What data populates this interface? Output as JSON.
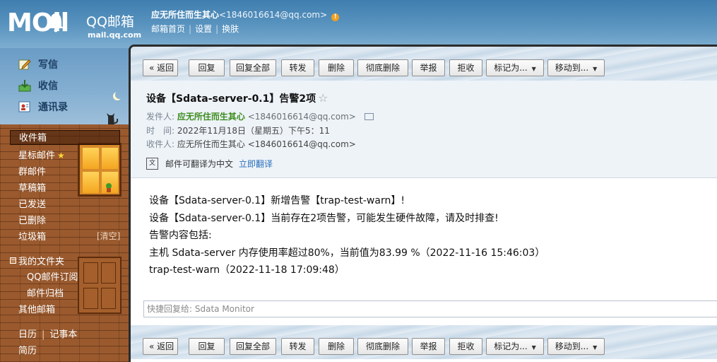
{
  "brand": {
    "logo_text": "MOil",
    "product_name": "QQ邮箱",
    "domain": "mail.qq.com"
  },
  "user": {
    "display_name": "应无所住而生其心",
    "email": "<1846016614@qq.com>",
    "warning_icon": "exclamation-icon"
  },
  "top_links": [
    "邮箱首页",
    "设置",
    "换肤"
  ],
  "quick_actions": [
    {
      "label": "写信",
      "icon": "pencil-icon"
    },
    {
      "label": "收信",
      "icon": "download-icon"
    },
    {
      "label": "通讯录",
      "icon": "contacts-icon"
    }
  ],
  "folders": {
    "inbox": "收件箱",
    "starred": "星标邮件",
    "group": "群邮件",
    "drafts": "草稿箱",
    "sent": "已发送",
    "deleted": "已删除",
    "spam": "垃圾箱",
    "clear_label": "[清空]",
    "my_folders": "我的文件夹",
    "my_folders_toggle": "−",
    "sub_folders": [
      "QQ邮件订阅",
      "邮件归档"
    ],
    "other_mailboxes": "其他邮箱",
    "calendar": "日历",
    "notes": "记事本",
    "resume": "简历"
  },
  "toolbar": {
    "back": "« 返回",
    "reply": "回复",
    "reply_all": "回复全部",
    "forward": "转发",
    "delete": "删除",
    "delete_permanently": "彻底删除",
    "report": "举报",
    "reject": "拒收",
    "mark_as": "标记为...",
    "move_to": "移动到..."
  },
  "mail": {
    "subject": "设备【Sdata-server-0.1】告警2项",
    "star": "☆",
    "from_label": "发件人:",
    "from_name": "应无所住而生其心",
    "from_addr": "<1846016614@qq.com>",
    "time_label": "时　间:",
    "time_value": "2022年11月18日（星期五）下午5：11",
    "to_label": "收件人:",
    "to_value": "应无所住而生其心 <1846016614@qq.com>",
    "translate_text": "邮件可翻译为中文",
    "translate_link": "立即翻译",
    "body": [
      "设备【Sdata-server-0.1】新增告警【trap-test-warn】!",
      "设备【Sdata-server-0.1】当前存在2项告警，可能发生硬件故障，请及时排查!",
      "告警内容包括:",
      "主机 Sdata-server 内存使用率超过80%，当前值为83.99 %（2022-11-16 15:46:03）",
      "trap-test-warn（2022-11-18 17:09:48）"
    ],
    "quick_reply_placeholder": "快捷回复给: Sdata Monitor"
  },
  "colors": {
    "header_blue": "#3f7eb0",
    "brick": "#9a5a2e",
    "sender_green": "#3d8c1e",
    "link_blue": "#2a6fb8"
  }
}
